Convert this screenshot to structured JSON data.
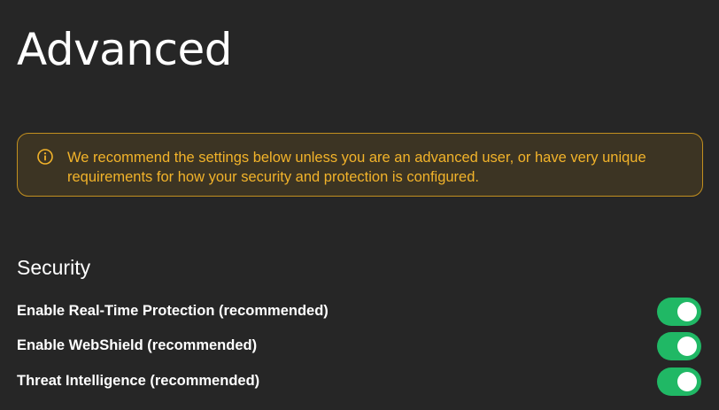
{
  "page": {
    "title": "Advanced"
  },
  "warning": {
    "icon": "info-circle-icon",
    "text": "We recommend the settings below unless you are an advanced user, or have very unique requirements for how your security and protection is configured.",
    "colors": {
      "text": "#f2b32a",
      "border": "#c28f1f",
      "background": "#3c3423"
    }
  },
  "security": {
    "title": "Security",
    "settings": [
      {
        "label": "Enable Real-Time Protection (recommended)",
        "enabled": true
      },
      {
        "label": "Enable WebShield (recommended)",
        "enabled": true
      },
      {
        "label": "Threat Intelligence (recommended)",
        "enabled": true
      }
    ],
    "toggle_on_color": "#20b865"
  }
}
